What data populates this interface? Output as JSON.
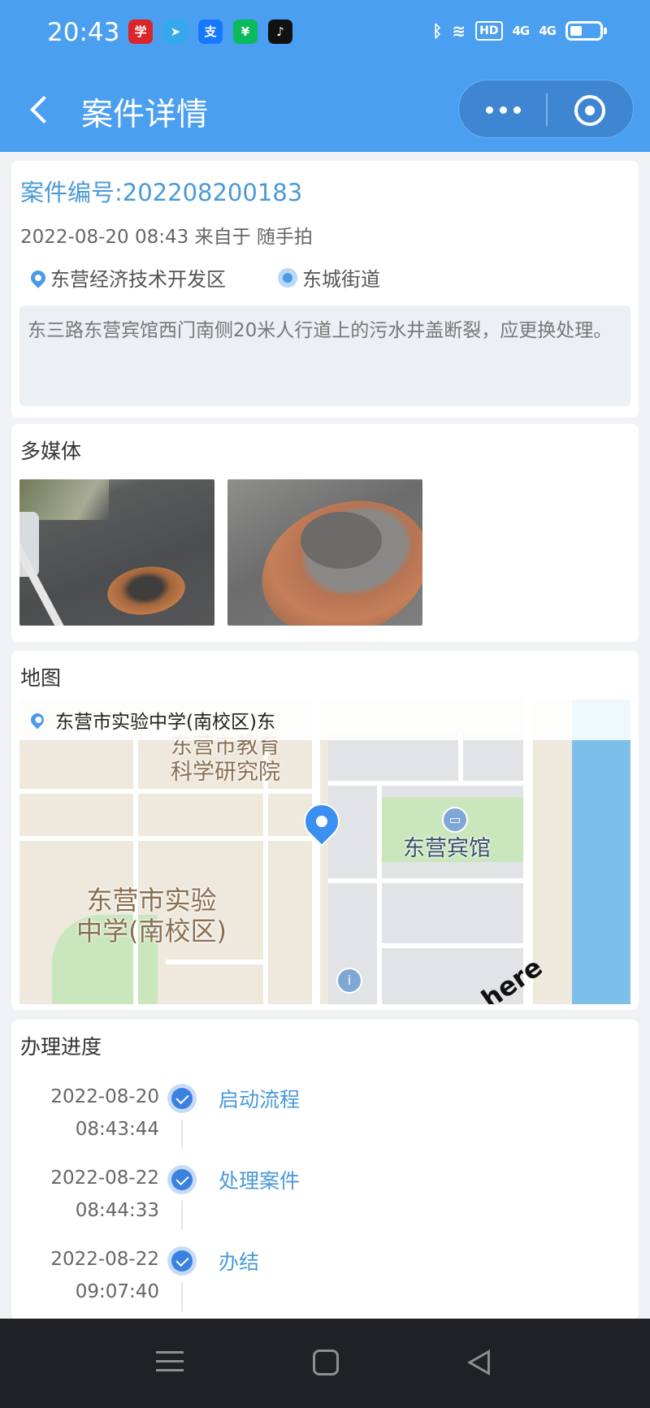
{
  "status_bar": {
    "time": "20:43",
    "app_icons": [
      "xuexi-icon",
      "telegram-icon",
      "alipay-icon",
      "wechat-pay-icon",
      "douyin-icon"
    ],
    "network": "HD",
    "signal1": "4G",
    "signal2": "4G"
  },
  "nav": {
    "title": "案件详情"
  },
  "case": {
    "number": "案件编号:202208200183",
    "meta": "2022-08-20 08:43 来自于 随手拍",
    "district": "东营经济技术开发区",
    "street": "东城街道",
    "description": "东三路东营宾馆西门南侧20米人行道上的污水井盖断裂，应更换处理。"
  },
  "media": {
    "title": "多媒体",
    "photos": [
      "broken-manhole-photo-1",
      "broken-manhole-photo-2"
    ]
  },
  "map": {
    "title": "地图",
    "address": "东营市实验中学(南校区)东",
    "labels": {
      "institute": "东营市教育\n科学研究院",
      "school": "东营市实验\n中学(南校区)",
      "hotel": "东营宾馆",
      "provider": "here"
    },
    "colors": {
      "water": "#7cc0ea",
      "green": "#c9e6bd"
    }
  },
  "progress": {
    "title": "办理进度",
    "steps": [
      {
        "date": "2022-08-20",
        "time": "08:43:44",
        "name": "启动流程"
      },
      {
        "date": "2022-08-22",
        "time": "08:44:33",
        "name": "处理案件"
      },
      {
        "date": "2022-08-22",
        "time": "09:07:40",
        "name": "办结"
      }
    ]
  },
  "theme": {
    "primary": "#4b9ff0",
    "link": "#4a9ad8"
  }
}
